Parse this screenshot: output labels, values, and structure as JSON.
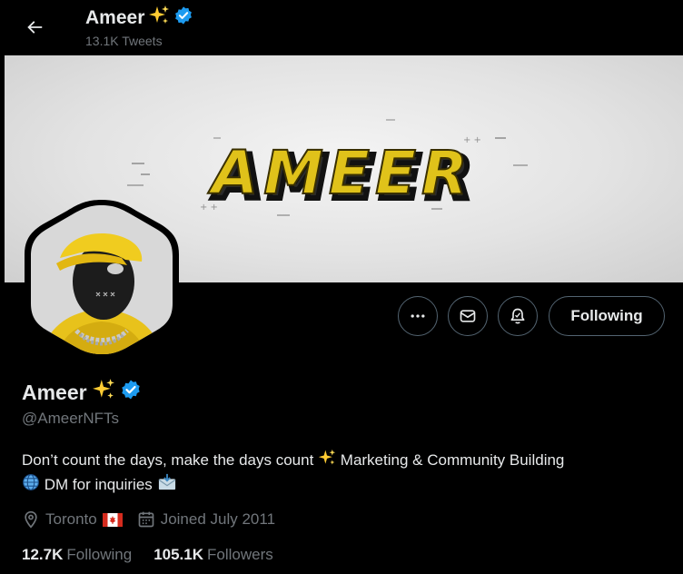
{
  "header": {
    "name": "Ameer",
    "name_emoji": "✨",
    "tweet_count": "13.1K Tweets"
  },
  "banner": {
    "logo_text": "AMEER"
  },
  "profile": {
    "display_name": "Ameer",
    "name_emoji": "✨",
    "handle": "@AmeerNFTs",
    "bio_line1_a": "Don’t count the days, make the days count",
    "bio_line1_b": "Marketing & Community Building",
    "bio_line2": "DM for inquiries",
    "location": "Toronto",
    "joined": "Joined July 2011"
  },
  "actions": {
    "following_label": "Following"
  },
  "stats": {
    "following_count": "12.7K",
    "following_label": "Following",
    "followers_count": "105.1K",
    "followers_label": "Followers"
  },
  "colors": {
    "background": "#000000",
    "verified": "#1d9bf0",
    "secondary_text": "#71767b",
    "primary_text": "#e7e9ea",
    "banner_logo": "#e0c21a"
  },
  "icons": [
    "back-arrow-icon",
    "verified-badge-icon",
    "sparkles-emoji",
    "more-icon",
    "message-icon",
    "notification-bell-icon",
    "location-icon",
    "canada-flag-icon",
    "calendar-icon",
    "globe-emoji",
    "envelope-emoji"
  ]
}
